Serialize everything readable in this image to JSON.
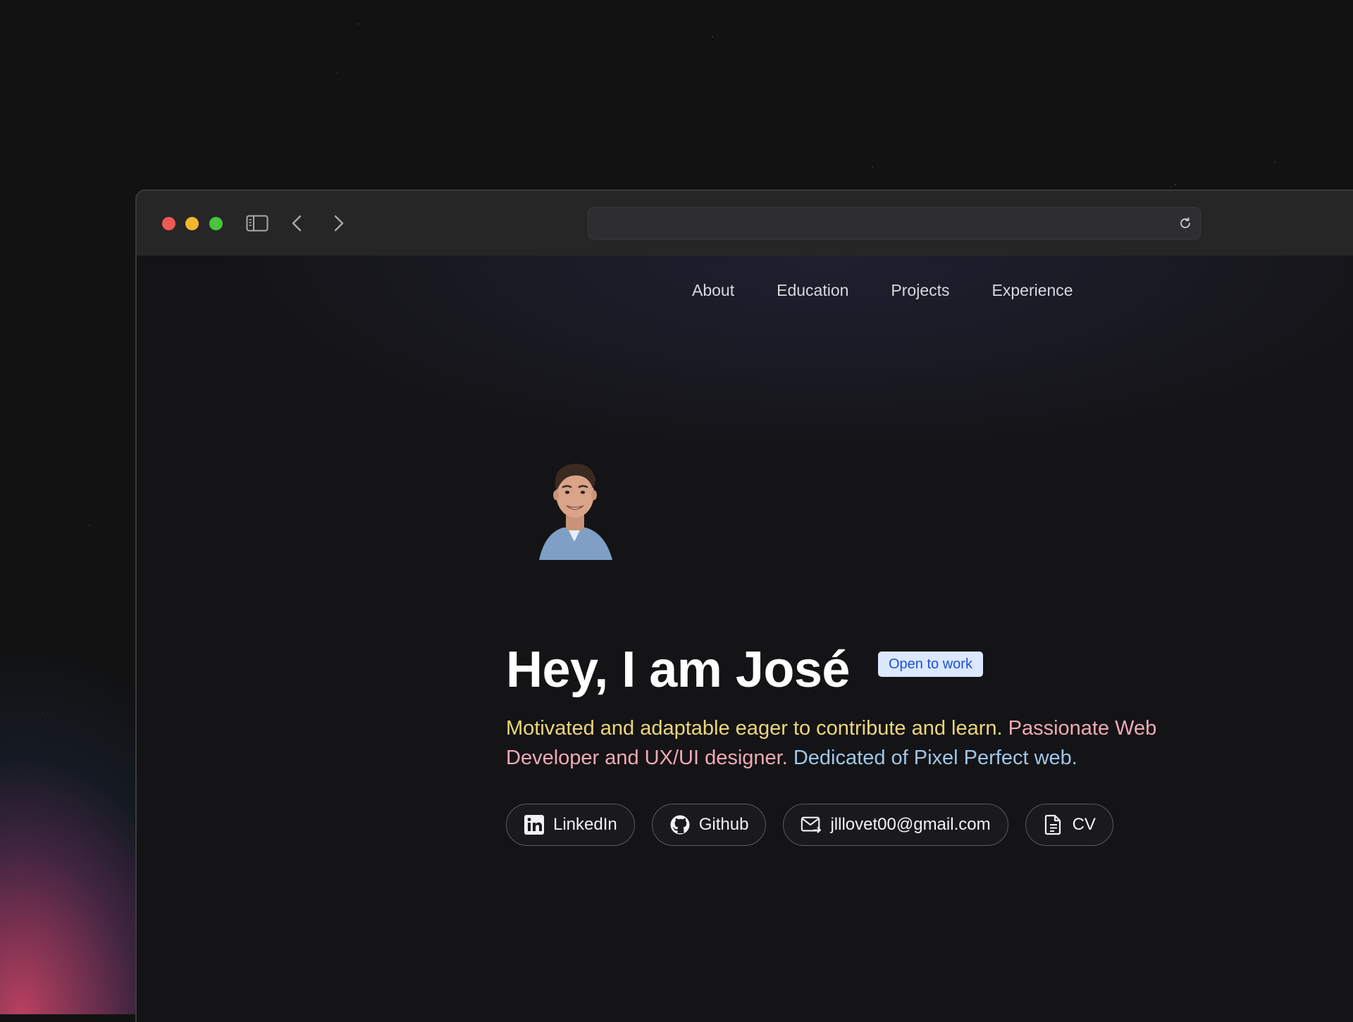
{
  "nav": {
    "items": [
      {
        "label": "About"
      },
      {
        "label": "Education"
      },
      {
        "label": "Projects"
      },
      {
        "label": "Experience"
      }
    ]
  },
  "hero": {
    "title": "Hey, I am José",
    "badge": "Open to work",
    "bio": {
      "part1": "Motivated and adaptable eager to contribute and learn.",
      "part2": "Passionate Web Developer and UX/UI designer.",
      "part3": "Dedicated of Pixel Perfect web."
    }
  },
  "links": {
    "linkedin": "LinkedIn",
    "github": "Github",
    "email": "jlllovet00@gmail.com",
    "cv": "CV"
  },
  "icons": {
    "linkedin": "linkedin-icon",
    "github": "github-icon",
    "email": "mail-icon",
    "cv": "document-icon",
    "sidebar": "sidebar-icon",
    "back": "chevron-left-icon",
    "forward": "chevron-right-icon",
    "reload": "reload-icon"
  },
  "colors": {
    "bio_yellow": "#ecd67a",
    "bio_pink": "#f0a9b7",
    "bio_blue": "#9fc6ea",
    "badge_bg": "#dbe8ff",
    "badge_text": "#1d4fd6",
    "traffic_red": "#ee5a52",
    "traffic_yellow": "#f3b62f",
    "traffic_green": "#48c43d"
  }
}
